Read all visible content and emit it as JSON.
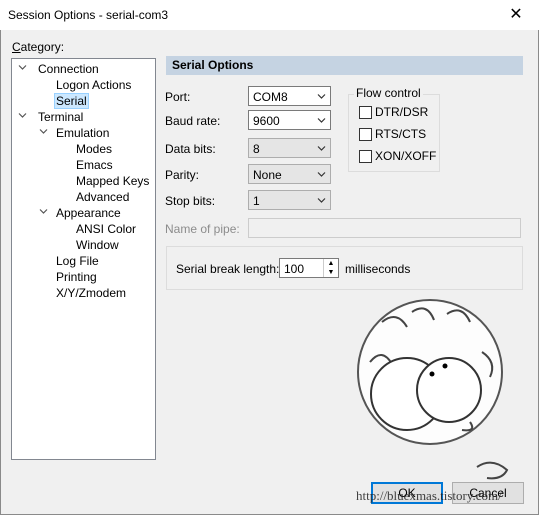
{
  "window": {
    "title": "Session Options - serial-com3",
    "close_glyph": "✕"
  },
  "category": {
    "label": "Category:",
    "tree": [
      {
        "label": "Connection",
        "level": 0,
        "expanded": true
      },
      {
        "label": "Logon Actions",
        "level": 1
      },
      {
        "label": "Serial",
        "level": 1,
        "selected": true
      },
      {
        "label": "Terminal",
        "level": 0,
        "expanded": true
      },
      {
        "label": "Emulation",
        "level": 1,
        "expanded": true
      },
      {
        "label": "Modes",
        "level": 2
      },
      {
        "label": "Emacs",
        "level": 2
      },
      {
        "label": "Mapped Keys",
        "level": 2
      },
      {
        "label": "Advanced",
        "level": 2
      },
      {
        "label": "Appearance",
        "level": 1,
        "expanded": true
      },
      {
        "label": "ANSI Color",
        "level": 2
      },
      {
        "label": "Window",
        "level": 2
      },
      {
        "label": "Log File",
        "level": 1
      },
      {
        "label": "Printing",
        "level": 1
      },
      {
        "label": "X/Y/Zmodem",
        "level": 1
      }
    ]
  },
  "serial": {
    "header": "Serial Options",
    "port": {
      "label": "Port:",
      "value": "COM8"
    },
    "baud_rate": {
      "label": "Baud rate:",
      "value": "9600"
    },
    "data_bits": {
      "label": "Data bits:",
      "value": "8"
    },
    "parity": {
      "label": "Parity:",
      "value": "None"
    },
    "stop_bits": {
      "label": "Stop bits:",
      "value": "1"
    },
    "name_of_pipe": {
      "label": "Name of pipe:",
      "value": ""
    },
    "flow_control": {
      "title": "Flow control",
      "options": [
        {
          "label": "DTR/DSR",
          "checked": false
        },
        {
          "label": "RTS/CTS",
          "checked": false
        },
        {
          "label": "XON/XOFF",
          "checked": false
        }
      ]
    },
    "serial_break": {
      "label": "Serial break length:",
      "value": "100",
      "unit": "milliseconds"
    }
  },
  "buttons": {
    "ok": "OK",
    "cancel": "Cancel"
  },
  "watermark": {
    "text": "http://bluexmas.tistory.com/"
  },
  "colors": {
    "header_bg": "#c5d3e2",
    "selection_bg": "#cce8ff",
    "accent": "#0078d7"
  }
}
